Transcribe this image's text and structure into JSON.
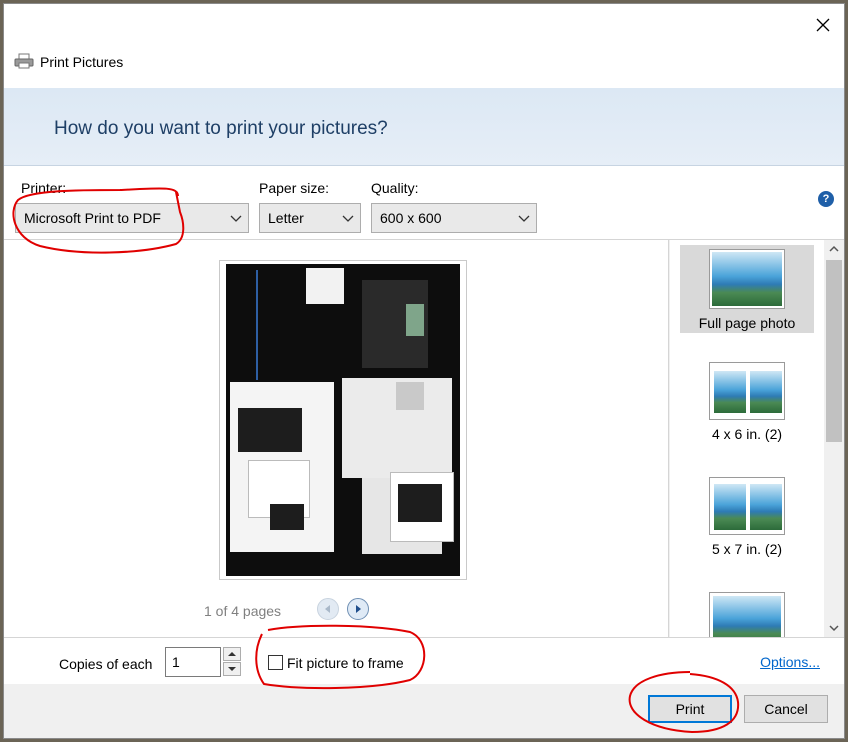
{
  "window": {
    "title": "Print Pictures"
  },
  "banner": {
    "heading": "How do you want to print your pictures?"
  },
  "printer": {
    "label": "Printer:",
    "value": "Microsoft Print to PDF"
  },
  "paper_size": {
    "label": "Paper size:",
    "value": "Letter"
  },
  "quality": {
    "label": "Quality:",
    "value": "600 x 600"
  },
  "help": {
    "glyph": "?"
  },
  "preview": {
    "page_indicator": "1 of 4 pages",
    "current_page": 1,
    "total_pages": 4
  },
  "layouts": [
    {
      "label": "Full page photo",
      "selected": true
    },
    {
      "label": "4 x 6 in. (2)",
      "selected": false
    },
    {
      "label": "5 x 7 in. (2)",
      "selected": false
    },
    {
      "label": "",
      "selected": false
    }
  ],
  "copies": {
    "label": "Copies of each",
    "value": "1"
  },
  "fit": {
    "label": "Fit picture to frame",
    "checked": false
  },
  "options_link": "Options...",
  "buttons": {
    "print": "Print",
    "cancel": "Cancel"
  },
  "colors": {
    "accent": "#0078d7",
    "banner_text": "#1e3f66",
    "annotation": "#e00000",
    "link": "#0066cc"
  }
}
